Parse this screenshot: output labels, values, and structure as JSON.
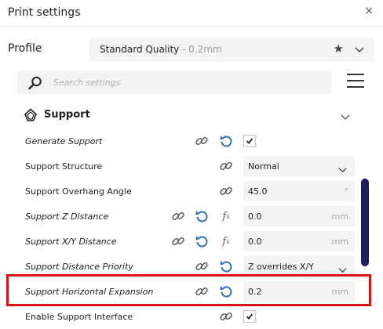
{
  "window": {
    "title": "Print settings",
    "close_glyph": "×"
  },
  "profile": {
    "label": "Profile",
    "name": "Standard Quality",
    "quality": " - 0.2mm"
  },
  "search": {
    "placeholder": "Search settings"
  },
  "section": {
    "title": "Support",
    "icon": "support-icon"
  },
  "settings": [
    {
      "label": "Generate Support",
      "italic": true,
      "checked": true
    },
    {
      "label": "Support Structure",
      "italic": false,
      "value": "Normal"
    },
    {
      "label": "Support Overhang Angle",
      "italic": false,
      "value": "45.0",
      "unit": "°"
    },
    {
      "label": "Support Z Distance",
      "italic": true,
      "value": "0.0",
      "unit": "mm"
    },
    {
      "label": "Support X/Y Distance",
      "italic": true,
      "value": "0.0",
      "unit": "mm"
    },
    {
      "label": "Support Distance Priority",
      "italic": true,
      "value": "Z overrides X/Y"
    },
    {
      "label": "Support Horizontal Expansion",
      "italic": true,
      "value": "0.2",
      "unit": "mm"
    },
    {
      "label": "Enable Support Interface",
      "italic": false,
      "checked": true
    }
  ],
  "colors": {
    "accent": "#2d6fb8",
    "highlight": "#d91219",
    "scrollbar": "#1a1e5c"
  }
}
